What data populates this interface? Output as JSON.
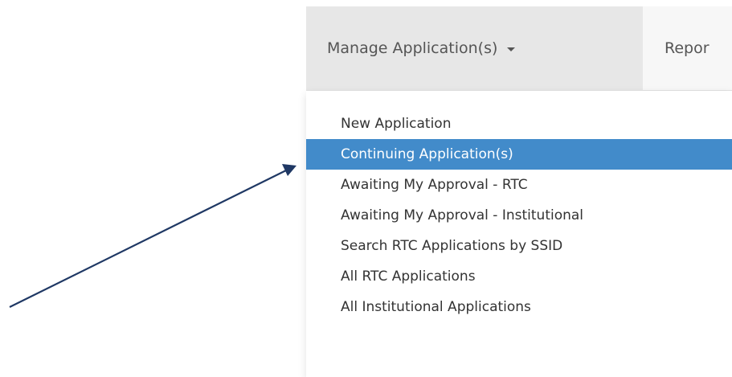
{
  "navbar": {
    "manage_label": "Manage Application(s)",
    "reports_label": "Repor"
  },
  "dropdown": {
    "items": [
      {
        "label": "New Application",
        "active": false
      },
      {
        "label": "Continuing Application(s)",
        "active": true
      },
      {
        "label": "Awaiting My Approval - RTC",
        "active": false
      },
      {
        "label": "Awaiting My Approval - Institutional",
        "active": false
      },
      {
        "label": "Search RTC Applications by SSID",
        "active": false
      },
      {
        "label": "All RTC Applications",
        "active": false
      },
      {
        "label": "All Institutional Applications",
        "active": false
      }
    ]
  },
  "colors": {
    "active_bg": "#428bca",
    "arrow": "#1f3864",
    "navbar_bg": "#f7f7f7",
    "nav_active_bg": "#e7e7e7"
  }
}
